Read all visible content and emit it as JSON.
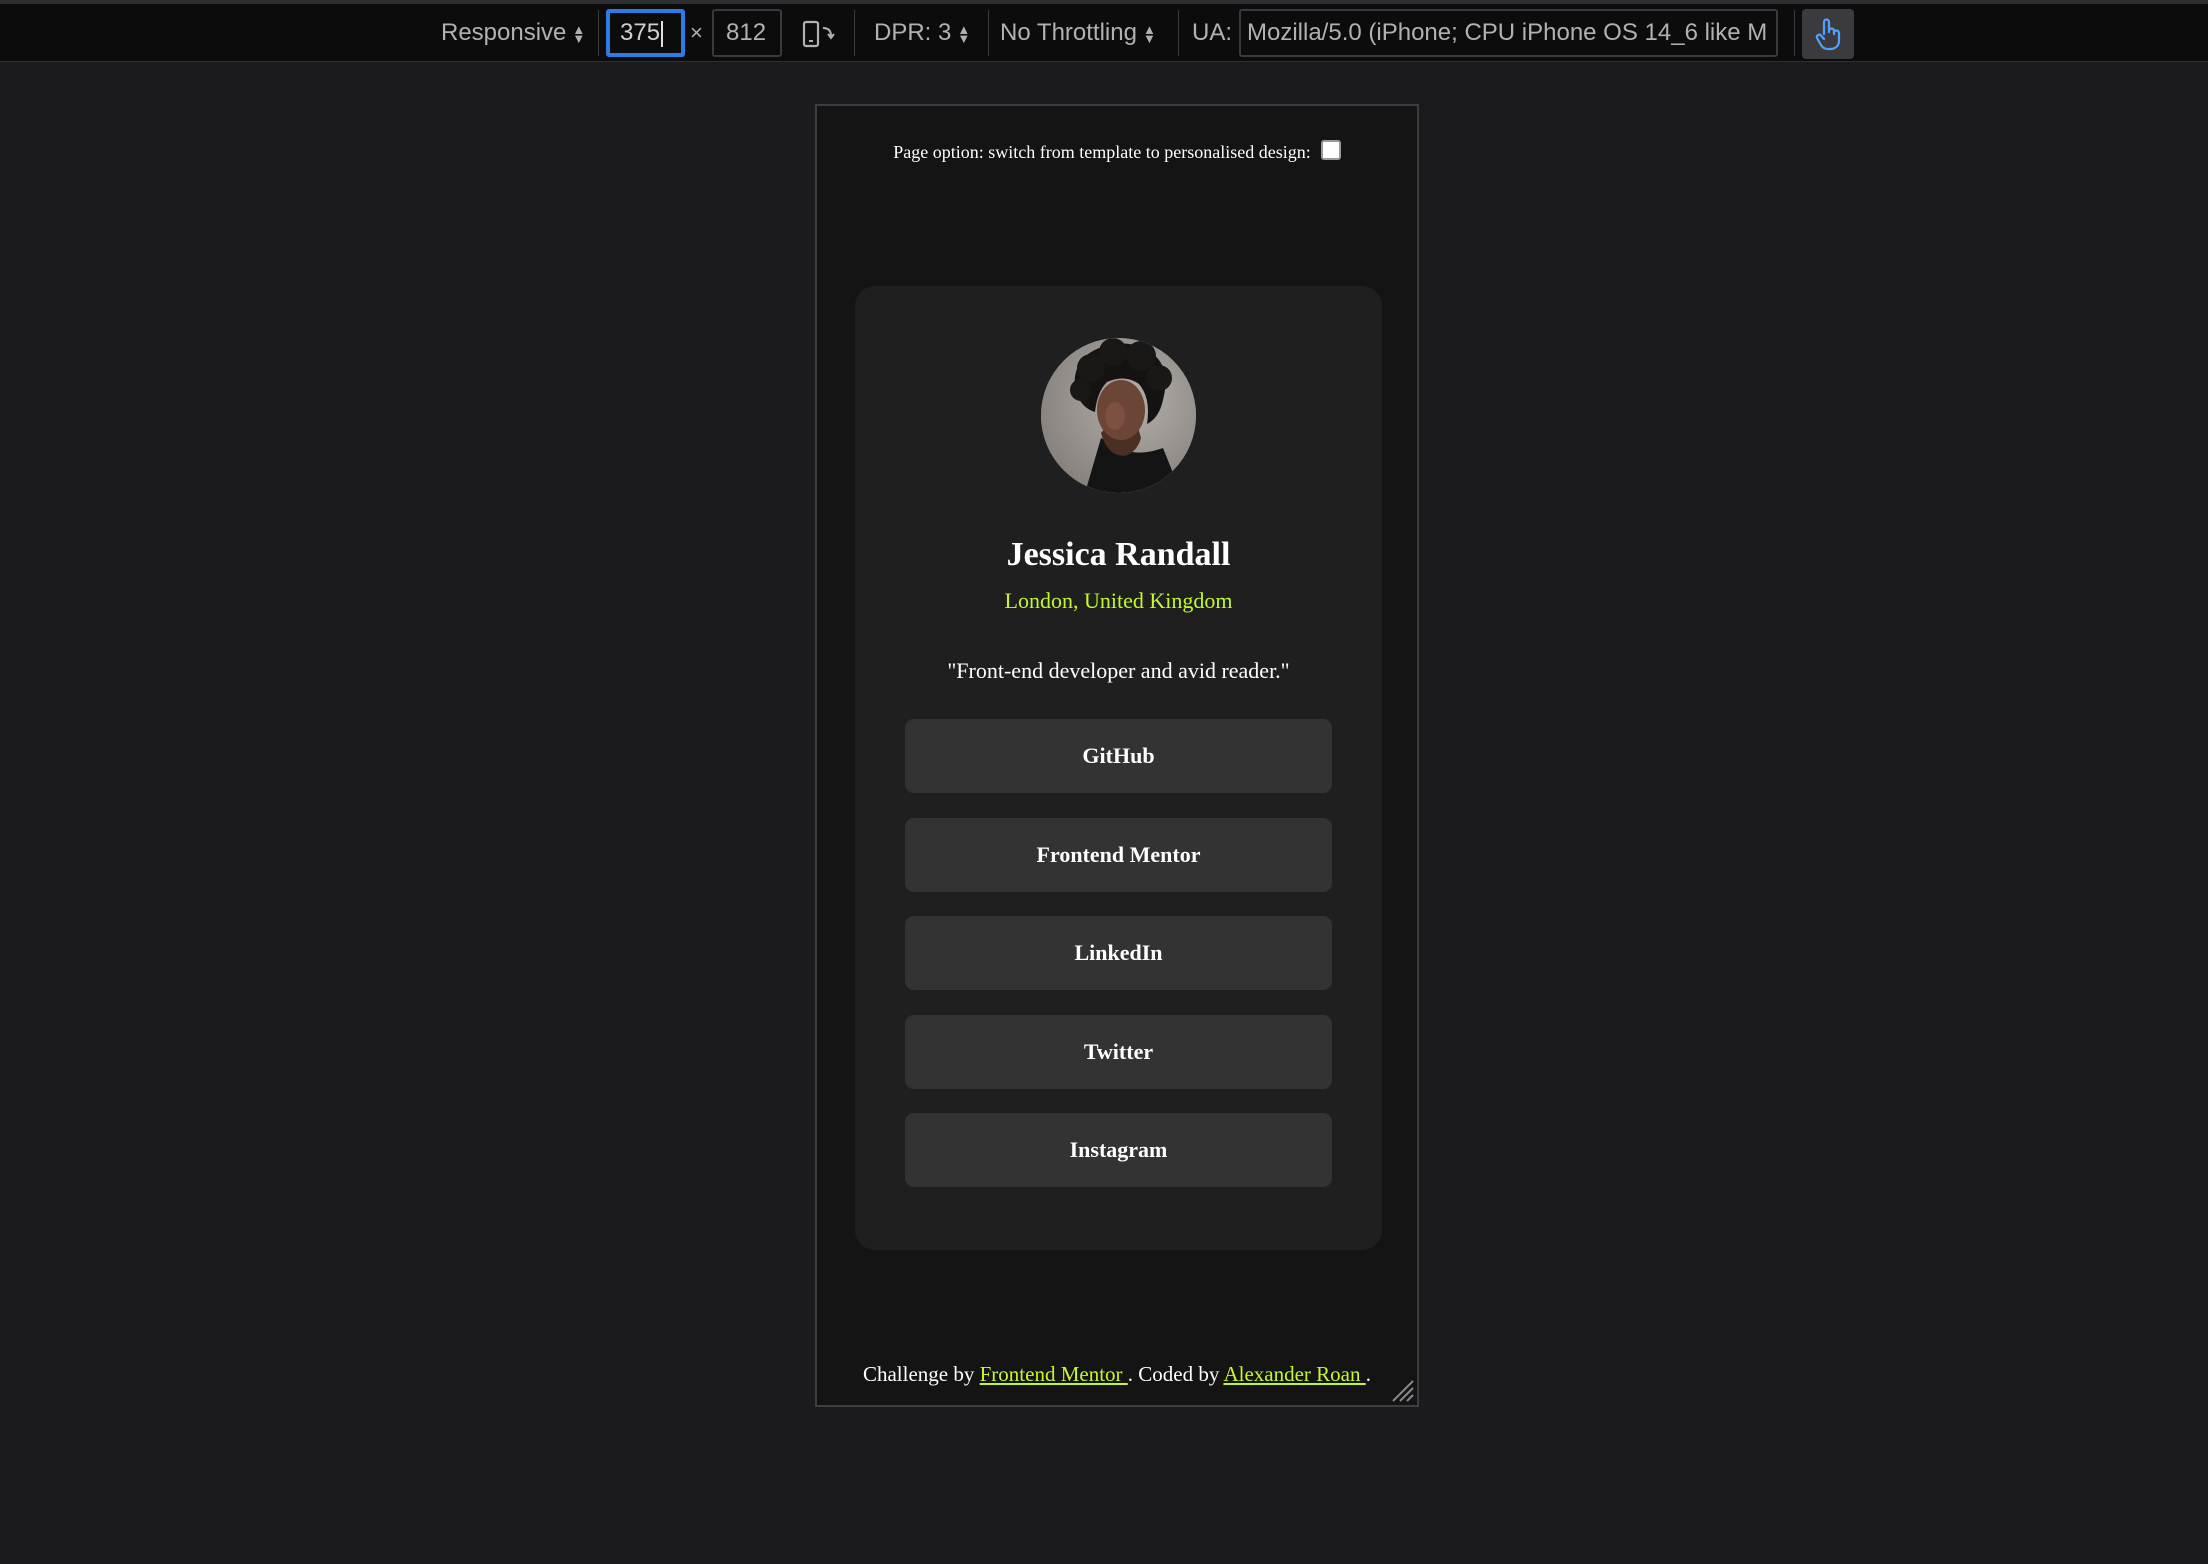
{
  "toolbar": {
    "device": "Responsive",
    "width": "375",
    "times": "×",
    "height": "812",
    "dpr": "DPR: 3",
    "throttling": "No Throttling",
    "ua_label": "UA:",
    "ua_value": "Mozilla/5.0 (iPhone; CPU iPhone OS 14_6 like M"
  },
  "page": {
    "option_text": "Page option: switch from template to personalised design:",
    "profile": {
      "name": "Jessica Randall",
      "location": "London, United Kingdom",
      "bio": "\"Front-end developer and avid reader.\""
    },
    "links": [
      "GitHub",
      "Frontend Mentor",
      "LinkedIn",
      "Twitter",
      "Instagram"
    ],
    "footer": {
      "prefix": "Challenge by ",
      "link1": "Frontend Mentor ",
      "middle": ". Coded by ",
      "link2": "Alexander Roan ",
      "suffix": "."
    }
  },
  "colors": {
    "accent": "#c4f82a",
    "card": "#1f1f1f",
    "button": "#333333",
    "focus": "#2f7be6"
  }
}
